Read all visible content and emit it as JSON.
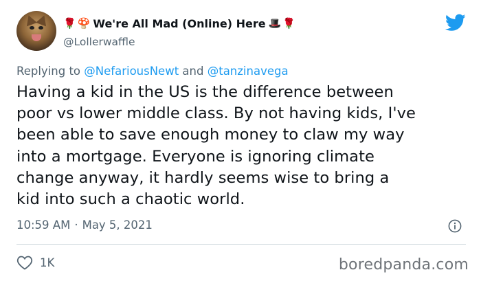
{
  "author": {
    "display_name": "We're All Mad (Online) Here",
    "emoji_before": [
      "🌹",
      "🍄"
    ],
    "emoji_after": [
      "🎩",
      "🌹"
    ],
    "handle": "@Lollerwaffle",
    "avatar_icon": "cat-avatar"
  },
  "platform_icon": "twitter-bird-icon",
  "colors": {
    "twitter_blue": "#1d9bf0",
    "secondary_text": "#536471",
    "primary_text": "#0f1419",
    "divider": "#cfd9de"
  },
  "reply_context": {
    "prefix": "Replying to",
    "mention_1": "@NefariousNewt",
    "joiner": "and",
    "mention_2": "@tanzinavega"
  },
  "tweet": {
    "text": "Having a kid in the US is the difference between\npoor vs lower middle class. By not having kids, I've\nbeen able to save enough money to claw my way\ninto a mortgage. Everyone is ignoring climate\nchange anyway, it hardly seems wise to bring a\nkid into such a chaotic world.",
    "time": "10:59 AM",
    "separator": "·",
    "date": "May 5, 2021"
  },
  "actions": {
    "like_count": "1K"
  },
  "watermark": "boredpanda.com"
}
